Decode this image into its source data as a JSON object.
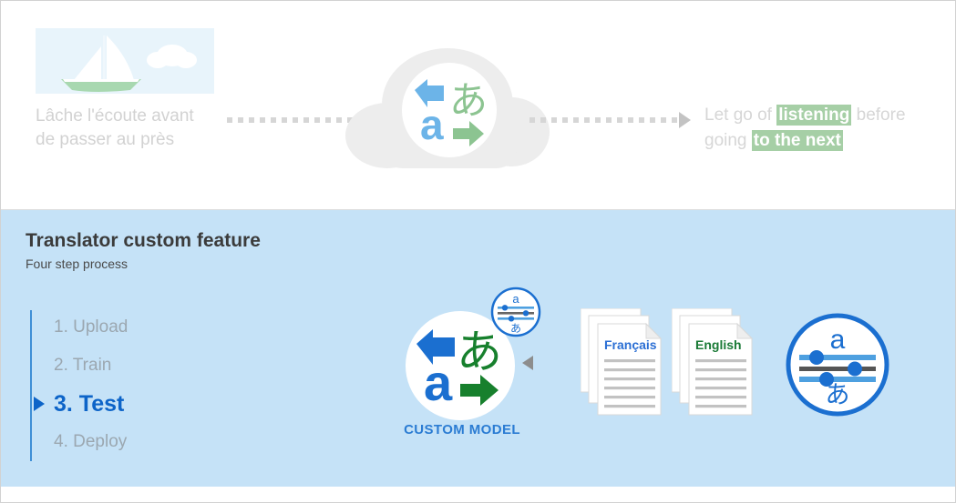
{
  "top": {
    "source": {
      "image_name": "sailboat-illustration",
      "caption": "Lâche l'écoute avant\nde passer au près"
    },
    "flow": {
      "arrow_1_name": "dotted-arrow-right",
      "arrow_2_name": "dotted-arrow-right",
      "cloud_name": "cloud-service",
      "translator_icon_name": "translator-icon"
    },
    "target": {
      "line1_pre": "Let go of ",
      "line1_highlight": "listening",
      "line1_post": " before",
      "line2_pre": "going ",
      "line2_highlight": "to the next"
    }
  },
  "panel": {
    "title": "Translator custom feature",
    "subtitle": "Four step process",
    "steps": [
      {
        "label": "1. Upload",
        "active": false
      },
      {
        "label": "2. Train",
        "active": false
      },
      {
        "label": "3. Test",
        "active": true
      },
      {
        "label": "4. Deploy",
        "active": false
      }
    ],
    "custom_model": {
      "label": "CUSTOM MODEL",
      "icon_name": "translator-icon",
      "badge_name": "tuning-sliders-badge",
      "latin_glyph": "a",
      "japanese_glyph": "あ"
    },
    "documents": [
      {
        "title": "Français",
        "color": "#2b6fd4",
        "line_count": 6
      },
      {
        "title": "English",
        "color": "#1a7a36",
        "line_count": 6
      }
    ],
    "settings_icon": {
      "name": "language-tuning-icon",
      "latin_glyph": "a",
      "japanese_glyph": "あ",
      "slider_count": 3
    }
  },
  "colors": {
    "panel_background": "#c5e2f7",
    "accent_blue": "#0d64c8",
    "translator_blue": "#4ea0e0",
    "translator_green": "#7dc082",
    "custom_model_blue": "#1b6fd0",
    "custom_model_green": "#17802d",
    "highlight_green": "#a6cfa6",
    "muted_gray": "#d2d2d2"
  }
}
